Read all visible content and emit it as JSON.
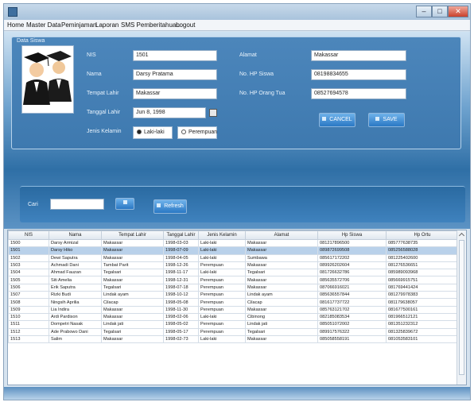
{
  "window": {
    "title": ""
  },
  "menu": [
    "Home",
    "Master Data",
    "Peminjaman",
    "Laporan",
    "SMS Pemberitahuan",
    "Logout"
  ],
  "panel": {
    "title": "Data Siswa"
  },
  "form": {
    "nis": {
      "label": "NIS",
      "value": "1501"
    },
    "nama": {
      "label": "Nama",
      "value": "Darsy Pratama"
    },
    "tempat_lahir": {
      "label": "Tempat Lahir",
      "value": "Makassar"
    },
    "tanggal_lahir": {
      "label": "Tanggal Lahir",
      "value": "Jun 8, 1998"
    },
    "jenis_kelamin": {
      "label": "Jenis Kelamin",
      "options": [
        "Laki-laki",
        "Perempuan"
      ],
      "selected": "Laki-laki"
    },
    "alamat": {
      "label": "Alamat",
      "value": "Makassar"
    },
    "no_hp_siswa": {
      "label": "No. HP Siswa",
      "value": "08198834655"
    },
    "no_hp_ortu": {
      "label": "No. HP Orang Tua",
      "value": "08527694578"
    }
  },
  "buttons": {
    "cancel": "CANCEL",
    "save": "SAVE"
  },
  "search": {
    "label": "Cari",
    "value": "",
    "button": "",
    "refresh": "Refresh"
  },
  "grid": {
    "columns": [
      "NIS",
      "Nama",
      "Tempat Lahir",
      "Tanggal Lahir",
      "Jenis Kelamin",
      "Alamat",
      "Hp Siswa",
      "Hp Ortu"
    ],
    "selected_row": 1,
    "rows": [
      [
        "1500",
        "Darsy Armizal",
        "Makassar",
        "1998-03-03",
        "Laki-laki",
        "Makassar",
        "081217896500",
        "085777638735"
      ],
      [
        "1501",
        "Darsy Hiko",
        "Makassar",
        "1998-07-09",
        "Laki-laki",
        "Makassar",
        "089872699508",
        "085256588028"
      ],
      [
        "1502",
        "Dewi Saputra",
        "Makassar",
        "1998-04-05",
        "Laki-laki",
        "Sumbawa",
        "085617172202",
        "081225402600"
      ],
      [
        "1503",
        "Achmadi Dani",
        "Tambat Parit",
        "1998-12-26",
        "Perempuan",
        "Makassar",
        "089926202604",
        "081276536651"
      ],
      [
        "1504",
        "Ahmad Fauzan",
        "Tegalsari",
        "1998-11-17",
        "Laki-laki",
        "Tegalsari",
        "081726632786",
        "085989093968"
      ],
      [
        "1505",
        "Siti Amelia",
        "Makassar",
        "1998-12-31",
        "Perempuan",
        "Makassar",
        "085635572706",
        "085669915751"
      ],
      [
        "1506",
        "Erik Saputra",
        "Tegalsari",
        "1998-07-18",
        "Perempuan",
        "Makassar",
        "087066916021",
        "081769441424"
      ],
      [
        "1507",
        "Rizki Budi",
        "Lindak ayam",
        "1998-10-12",
        "Perempuan",
        "Lindak ayam",
        "085636557844",
        "081279978383"
      ],
      [
        "1508",
        "Ningsih Aprilia",
        "Cilacap",
        "1998-05-08",
        "Perempuan",
        "Cilacap",
        "081617737722",
        "081179638057"
      ],
      [
        "1509",
        "Lia Indira",
        "Makassar",
        "1998-11-30",
        "Perempuan",
        "Makassar",
        "085763121702",
        "081677500161"
      ],
      [
        "1510",
        "Ardi Pardison",
        "Makassar",
        "1998-02-06",
        "Laki-laki",
        "Cibinong",
        "082185083534",
        "081966512121"
      ],
      [
        "1511",
        "Dompetri Nasak",
        "Lindak jati",
        "1998-05-02",
        "Perempuan",
        "Lindak jati",
        "085051072002",
        "081351232312"
      ],
      [
        "1512",
        "Ade Prabowo Dani",
        "Tegalsari",
        "1998-05-17",
        "Perempuan",
        "Tegalsari",
        "089917576322",
        "081325839672"
      ],
      [
        "1513",
        "Salim",
        "Makassar",
        "1998-02-73",
        "Laki-laki",
        "Makassar",
        "085058558191",
        "081053583101"
      ]
    ]
  }
}
